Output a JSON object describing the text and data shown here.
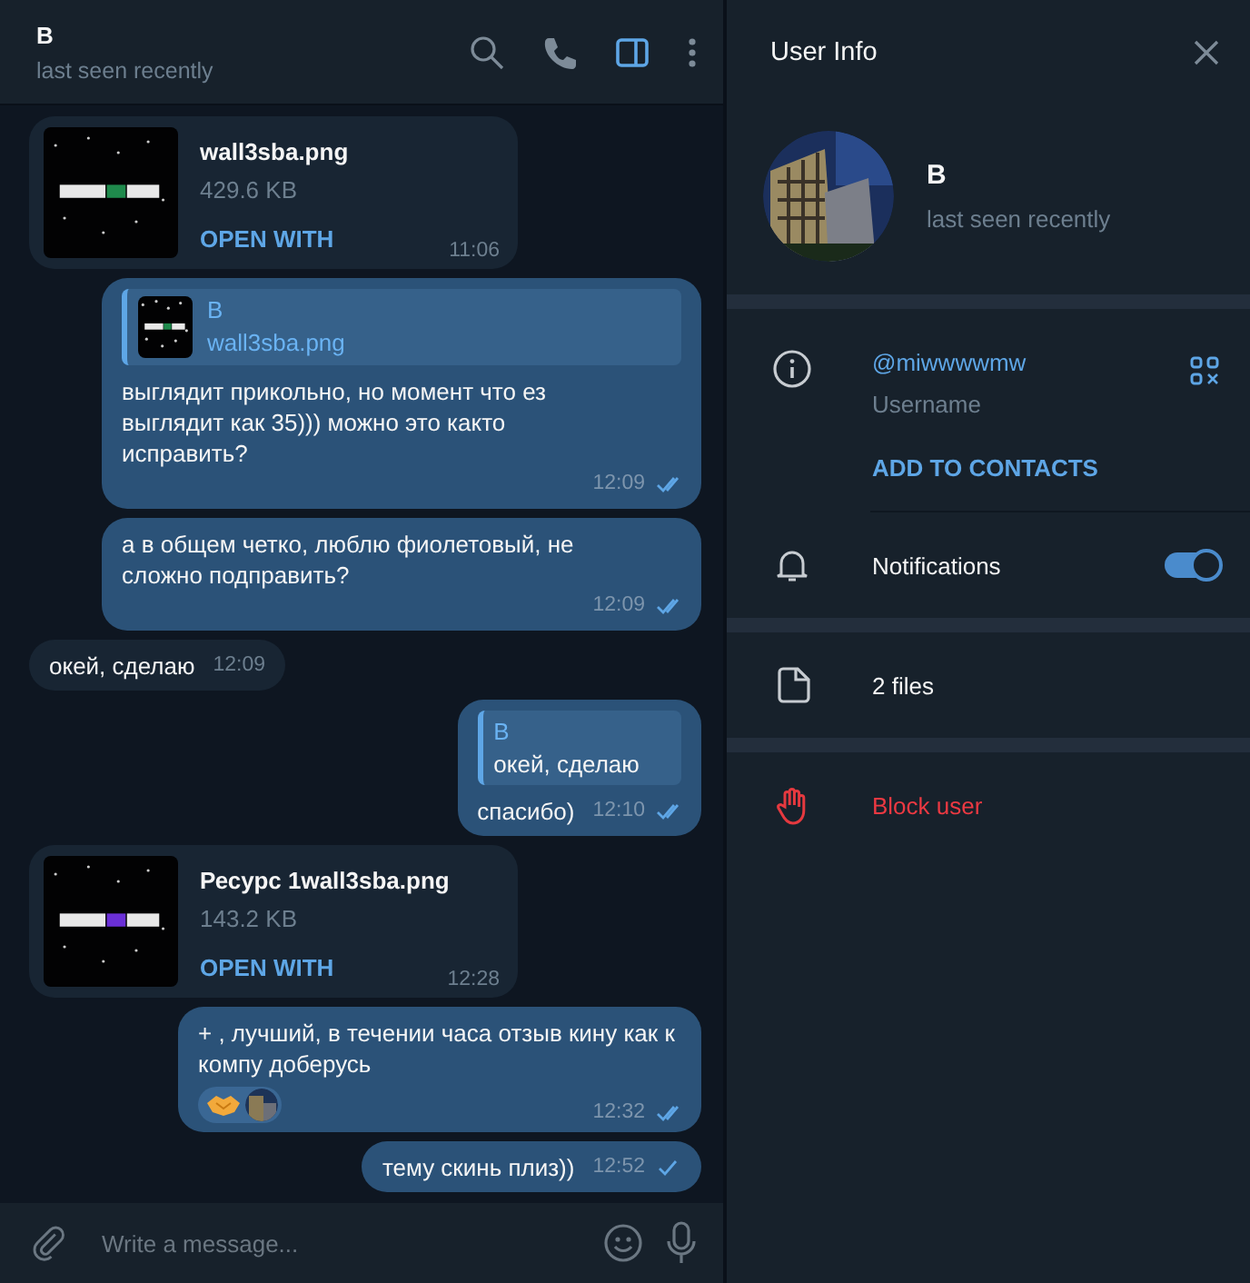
{
  "chat_header": {
    "name": "B",
    "status": "last seen recently"
  },
  "messages": [
    {
      "kind": "file",
      "outgoing": false,
      "file_name": "wall3sba.png",
      "size": "429.6 KB",
      "action": "OPEN WITH",
      "time": "11:06"
    },
    {
      "kind": "reply",
      "outgoing": true,
      "reply": {
        "author": "B",
        "text": "wall3sba.png",
        "thumbnail": true
      },
      "text": "выглядит прикольно, но момент что ез выглядит как 35))) можно это както исправить?",
      "time": "12:09",
      "read": true
    },
    {
      "kind": "text",
      "outgoing": true,
      "text": "а в общем четко, люблю фиолетовый, не сложно подправить?",
      "time": "12:09",
      "read": true
    },
    {
      "kind": "text",
      "outgoing": false,
      "text": "окей, сделаю",
      "time": "12:09"
    },
    {
      "kind": "reply",
      "outgoing": true,
      "reply": {
        "author": "B",
        "text": "окей, сделаю",
        "thumbnail": false
      },
      "text": "спасибо)",
      "time": "12:10",
      "read": true
    },
    {
      "kind": "file",
      "outgoing": false,
      "file_name": "Ресурс 1wall3sba.png",
      "size": "143.2 KB",
      "action": "OPEN WITH",
      "time": "12:28"
    },
    {
      "kind": "text",
      "outgoing": true,
      "text": "+ , лучший, в течении часа отзыв кину как к компу доберусь",
      "reactions": [
        {
          "kind": "emoji"
        },
        {
          "kind": "avatar"
        }
      ],
      "time": "12:32",
      "read": true
    },
    {
      "kind": "text",
      "outgoing": true,
      "text": "тему скинь плиз))",
      "time": "12:52",
      "read": false
    }
  ],
  "composer": {
    "placeholder": "Write a message..."
  },
  "info_panel": {
    "title": "User Info",
    "name": "B",
    "status": "last seen recently",
    "username": "@miwwwwmw",
    "username_label": "Username",
    "add_contact": "ADD TO CONTACTS",
    "notifications": {
      "label": "Notifications",
      "on": true
    },
    "files": "2 files",
    "block": "Block user"
  }
}
